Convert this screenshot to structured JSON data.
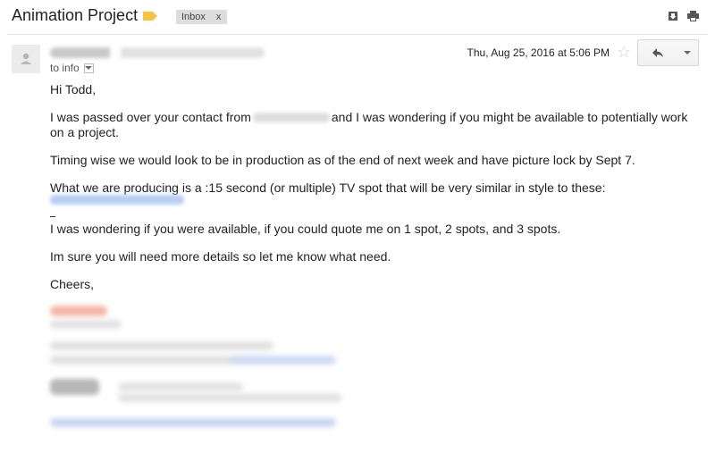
{
  "header": {
    "subject": "Animation Project",
    "label": "Inbox",
    "label_close": "x"
  },
  "message": {
    "to_line": "to info",
    "date": "Thu, Aug 25, 2016 at 5:06 PM",
    "greeting": "Hi Todd,",
    "para1_start": "I was passed over your contact from",
    "para1_end": "and I was wondering if you might be available to potentially work",
    "para1_line2": "on a project.",
    "para2": "Timing wise we would look to be in production as of the end of next week and have picture lock by Sept 7.",
    "para3": "What we are producing is a :15 second (or multiple) TV spot that will be very similar in style to these:",
    "para4": "I was wondering if you were available, if you could quote me on 1 spot, 2 spots, and 3 spots.",
    "para5": "Im sure you will need more details so let me know what need.",
    "signoff": "Cheers,"
  },
  "icons": {
    "important": "label-important-icon",
    "download": "download-icon",
    "print": "print-icon",
    "star": "star-icon",
    "reply": "reply-icon",
    "more": "chevron-down-icon",
    "avatar": "avatar-icon"
  },
  "colors": {
    "important_marker": "#f4c542",
    "label_chip_bg": "#dddddd",
    "link_blur": "#b9cdf2"
  }
}
